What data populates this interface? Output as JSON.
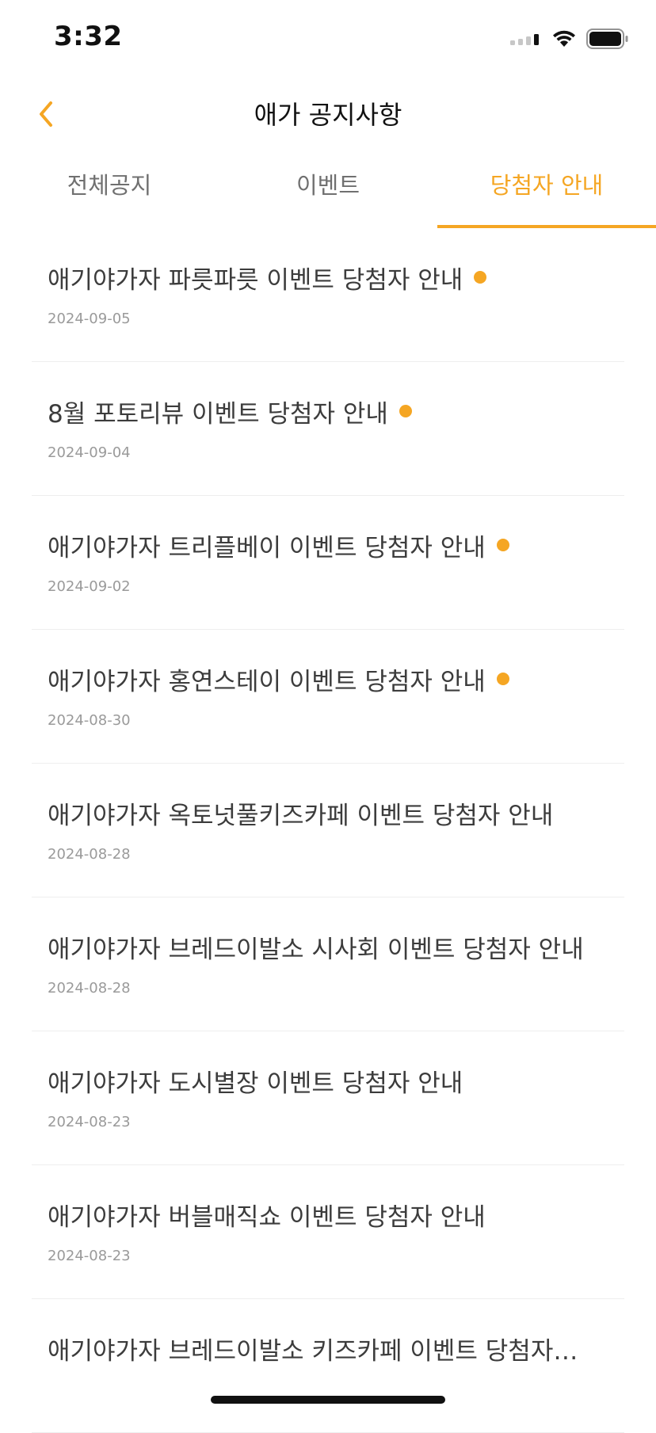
{
  "status_bar": {
    "time": "3:32"
  },
  "header": {
    "title": "애가 공지사항",
    "back_icon": "chevron-left-icon"
  },
  "tabs": [
    {
      "label": "전체공지",
      "active": false
    },
    {
      "label": "이벤트",
      "active": false
    },
    {
      "label": "당첨자 안내",
      "active": true
    }
  ],
  "notices": [
    {
      "title": "애기야가자 파릇파릇 이벤트 당첨자 안내",
      "date": "2024-09-05",
      "is_new": true
    },
    {
      "title": "8월 포토리뷰 이벤트 당첨자 안내",
      "date": "2024-09-04",
      "is_new": true
    },
    {
      "title": "애기야가자 트리플베이 이벤트 당첨자 안내",
      "date": "2024-09-02",
      "is_new": true
    },
    {
      "title": "애기야가자 홍연스테이 이벤트 당첨자 안내",
      "date": "2024-08-30",
      "is_new": true
    },
    {
      "title": "애기야가자 옥토넛풀키즈카페 이벤트 당첨자 안내",
      "date": "2024-08-28",
      "is_new": false
    },
    {
      "title": "애기야가자 브레드이발소 시사회 이벤트 당첨자 안내",
      "date": "2024-08-28",
      "is_new": false
    },
    {
      "title": "애기야가자 도시별장 이벤트 당첨자 안내",
      "date": "2024-08-23",
      "is_new": false
    },
    {
      "title": "애기야가자 버블매직쇼 이벤트 당첨자 안내",
      "date": "2024-08-23",
      "is_new": false
    },
    {
      "title": "애기야가자 브레드이발소 키즈카페 이벤트 당첨자…",
      "date": "",
      "is_new": false
    }
  ],
  "colors": {
    "accent": "#f5a623",
    "text": "#3c3c3c",
    "date": "#9a9a9a"
  }
}
